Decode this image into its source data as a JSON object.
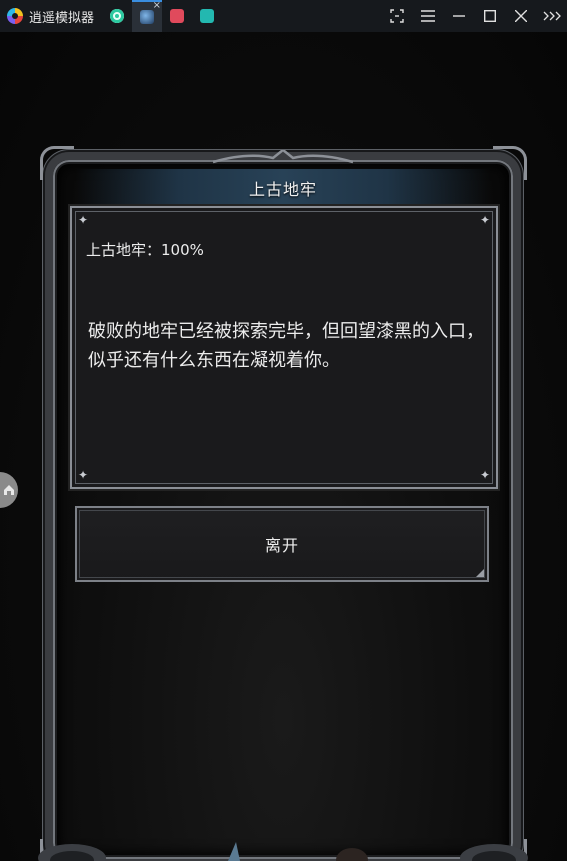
{
  "emulator": {
    "title": "逍遥模拟器",
    "tabs": [
      {
        "icon": "green-app-icon",
        "active": false
      },
      {
        "icon": "game-app-icon",
        "active": true
      },
      {
        "icon": "red-app-icon",
        "active": false
      },
      {
        "icon": "teal-home-icon",
        "active": false
      }
    ],
    "tab_close_glyph": "×"
  },
  "dialog": {
    "title": "上古地牢",
    "status": "上古地牢：100%",
    "body": "破败的地牢已经被探索完毕，但回望漆黑的入口，似乎还有什么东西在凝视着你。",
    "leave_label": "离开"
  },
  "colors": {
    "title_bar": "#16191d",
    "header_band": "#284257",
    "panel_bg": "#1a1a1c",
    "panel_border": "#8b8f96",
    "text": "#ececec"
  }
}
